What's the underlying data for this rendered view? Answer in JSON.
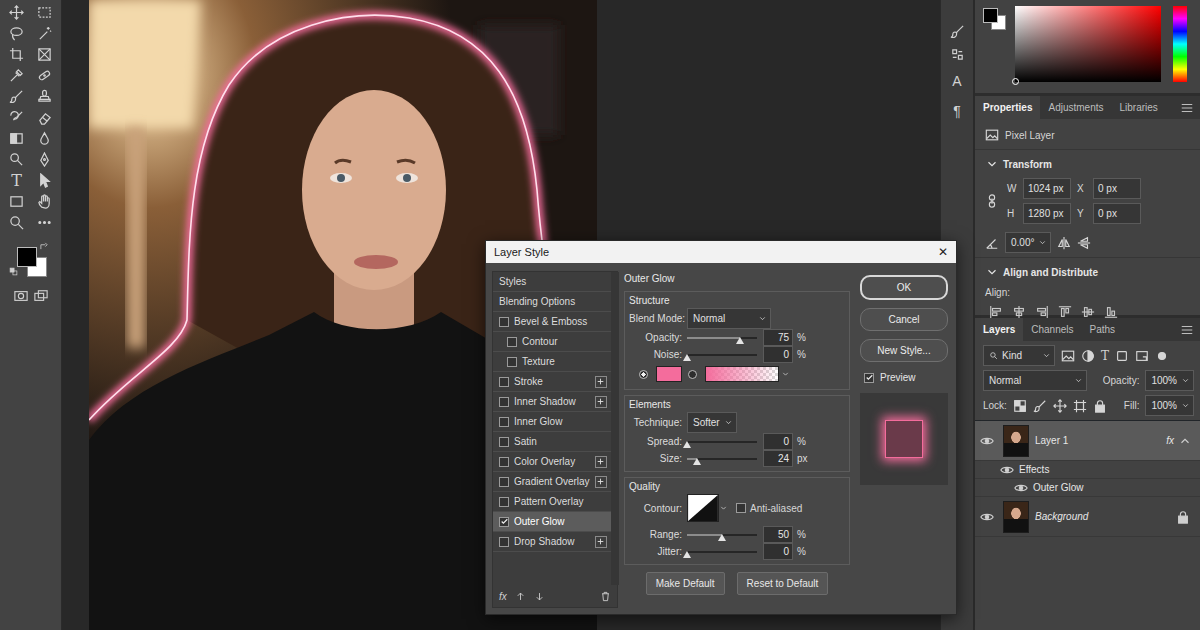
{
  "toolbar": {
    "type_tool": "T"
  },
  "colors": {
    "foreground": "#000000",
    "background": "#ffffff",
    "hue_color": "#ff0000"
  },
  "side_strip": {
    "glyphs": [
      "A",
      "¶"
    ]
  },
  "properties": {
    "tabs": [
      {
        "label": "Properties",
        "selected": true
      },
      {
        "label": "Adjustments",
        "selected": false
      },
      {
        "label": "Libraries",
        "selected": false
      }
    ],
    "layer_type": "Pixel Layer",
    "transform": {
      "title": "Transform",
      "expanded": true,
      "fields": [
        {
          "label": "W",
          "value": "1024 px"
        },
        {
          "label": "X",
          "value": "0 px"
        },
        {
          "label": "H",
          "value": "1280 px"
        },
        {
          "label": "Y",
          "value": "0 px"
        }
      ],
      "angle": "0.00°"
    },
    "align": {
      "title": "Align and Distribute",
      "expanded": true,
      "label": "Align:"
    }
  },
  "layers": {
    "tabs": [
      {
        "label": "Layers",
        "selected": true
      },
      {
        "label": "Channels",
        "selected": false
      },
      {
        "label": "Paths",
        "selected": false
      }
    ],
    "filter": "Kind",
    "type_filter": "T",
    "blend_mode": "Normal",
    "opacity_label": "Opacity:",
    "opacity": "100%",
    "lock_label": "Lock:",
    "fill_label": "Fill:",
    "fill": "100%",
    "items": [
      {
        "kind": "layer",
        "name": "Layer 1",
        "visible": true,
        "selected": true,
        "fx": "fx",
        "expanded": true
      },
      {
        "kind": "effects",
        "name": "Effects",
        "visible": true
      },
      {
        "kind": "effect",
        "name": "Outer Glow",
        "visible": true
      },
      {
        "kind": "layer",
        "name": "Background",
        "visible": true,
        "selected": false,
        "locked": true
      }
    ]
  },
  "dialog": {
    "title": "Layer Style",
    "close": "✕",
    "styles": [
      {
        "label": "Styles",
        "kind": "header",
        "selected": false
      },
      {
        "label": "Blending Options",
        "kind": "header",
        "selected": false
      },
      {
        "label": "Bevel & Emboss",
        "kind": "check",
        "checked": false,
        "addable": false,
        "selected": false
      },
      {
        "label": "Contour",
        "kind": "sub",
        "checked": false,
        "addable": false,
        "selected": false
      },
      {
        "label": "Texture",
        "kind": "sub",
        "checked": false,
        "addable": false,
        "selected": false
      },
      {
        "label": "Stroke",
        "kind": "check",
        "checked": false,
        "addable": true,
        "selected": false
      },
      {
        "label": "Inner Shadow",
        "kind": "check",
        "checked": false,
        "addable": true,
        "selected": false
      },
      {
        "label": "Inner Glow",
        "kind": "check",
        "checked": false,
        "addable": false,
        "selected": false
      },
      {
        "label": "Satin",
        "kind": "check",
        "checked": false,
        "addable": false,
        "selected": false
      },
      {
        "label": "Color Overlay",
        "kind": "check",
        "checked": false,
        "addable": true,
        "selected": false
      },
      {
        "label": "Gradient Overlay",
        "kind": "check",
        "checked": false,
        "addable": true,
        "selected": false
      },
      {
        "label": "Pattern Overlay",
        "kind": "check",
        "checked": false,
        "addable": false,
        "selected": false
      },
      {
        "label": "Outer Glow",
        "kind": "check",
        "checked": true,
        "addable": false,
        "selected": true
      },
      {
        "label": "Drop Shadow",
        "kind": "check",
        "checked": false,
        "addable": true,
        "selected": false
      }
    ],
    "list_footer": "fx",
    "section": "Outer Glow",
    "structure": {
      "title": "Structure",
      "blend_label": "Blend Mode:",
      "blend_mode": "Normal",
      "color": "#f46c9c",
      "sliders": [
        {
          "label": "Opacity:",
          "value": "75",
          "unit": "%",
          "level": 0.75
        },
        {
          "label": "Noise:",
          "value": "0",
          "unit": "%",
          "level": 0
        }
      ],
      "fill": [
        {
          "kind": "color",
          "selected": true
        },
        {
          "kind": "gradient",
          "selected": false
        }
      ]
    },
    "elements": {
      "title": "Elements",
      "technique_label": "Technique:",
      "technique": "Softer",
      "sliders": [
        {
          "label": "Spread:",
          "value": "0",
          "unit": "%",
          "level": 0
        },
        {
          "label": "Size:",
          "value": "24",
          "unit": "px",
          "level": 0.14
        }
      ]
    },
    "quality": {
      "title": "Quality",
      "contour_label": "Contour:",
      "anti_aliased": {
        "label": "Anti-aliased",
        "checked": false
      },
      "sliders": [
        {
          "label": "Range:",
          "value": "50",
          "unit": "%",
          "level": 0.5
        },
        {
          "label": "Jitter:",
          "value": "0",
          "unit": "%",
          "level": 0
        }
      ]
    },
    "defaults": [
      "Make Default",
      "Reset to Default"
    ],
    "buttons": [
      {
        "label": "OK",
        "default": true
      },
      {
        "label": "Cancel",
        "default": false
      },
      {
        "label": "New Style...",
        "default": false
      }
    ],
    "preview": {
      "label": "Preview",
      "checked": true
    }
  }
}
